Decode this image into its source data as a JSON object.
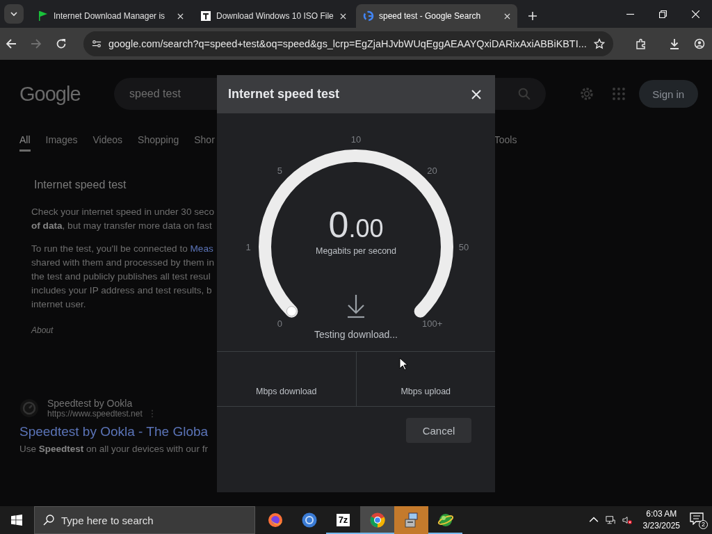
{
  "browser": {
    "tabs": [
      {
        "kind": "flag",
        "title": "Internet Download Manager is",
        "selected": false
      },
      {
        "kind": "document",
        "title": "Download Windows 10 ISO File",
        "selected": false
      },
      {
        "kind": "google",
        "title": "speed test - Google Search",
        "selected": true
      }
    ],
    "address": "google.com/search?q=speed+test&oq=speed&gs_lcrp=EgZjaHJvbWUqEggAEAAYQxiDARixAxiABBiKBTI..."
  },
  "page": {
    "logo": "Google",
    "query": "speed test",
    "nav": [
      {
        "label": "All",
        "selected": true
      },
      {
        "label": "Images",
        "selected": false
      },
      {
        "label": "Videos",
        "selected": false
      },
      {
        "label": "Shopping",
        "selected": false
      },
      {
        "label": "Shor",
        "selected": false
      }
    ],
    "tools": "Tools",
    "sign_in": "Sign in",
    "card": {
      "title": "Internet speed test",
      "paragraphs": [
        [
          {
            "text": "Check your internet speed in under 30 seco"
          },
          {
            "text": "**of data**, but may transfer more data on fast"
          }
        ],
        [
          {
            "text": "To run the test, you'll be connected to ",
            "link": "Meas"
          },
          {
            "text": "shared with them and processed by them in"
          },
          {
            "text": "the test and publicly publishes all test resul"
          },
          {
            "text": "includes your IP address and test results, b"
          },
          {
            "text": "internet user."
          }
        ]
      ],
      "about": "About"
    },
    "result": {
      "site": "Speedtest by Ookla",
      "url": "https://www.speedtest.net",
      "title": "Speedtest by Ookla - The Globa",
      "snippet": "Use **Speedtest** on all your devices with our fr"
    }
  },
  "dialog": {
    "title": "Internet speed test",
    "scale": [
      "0",
      "1",
      "5",
      "10",
      "20",
      "50",
      "100+"
    ],
    "value": "0.00",
    "unit": "Megabits per second",
    "status": "Testing download...",
    "results": [
      {
        "label": "Mbps download"
      },
      {
        "label": "Mbps upload"
      }
    ],
    "cancel": "Cancel"
  },
  "taskbar": {
    "search": {
      "placeholder": "Type here to search"
    },
    "apps": [
      {
        "kind": "firefox",
        "running": false,
        "selected": false,
        "attention": false
      },
      {
        "kind": "browser",
        "running": false,
        "selected": false,
        "attention": false
      },
      {
        "kind": "archiver",
        "icon_text": "7z",
        "running": true,
        "selected": false,
        "attention": false
      },
      {
        "kind": "chrome",
        "running": true,
        "selected": true,
        "attention": false
      },
      {
        "kind": "installer",
        "running": false,
        "selected": false,
        "attention": true
      },
      {
        "kind": "globe",
        "running": true,
        "selected": false,
        "attention": false
      }
    ],
    "time": "6:03 AM",
    "date": "3/23/2025",
    "notifications": "2"
  }
}
